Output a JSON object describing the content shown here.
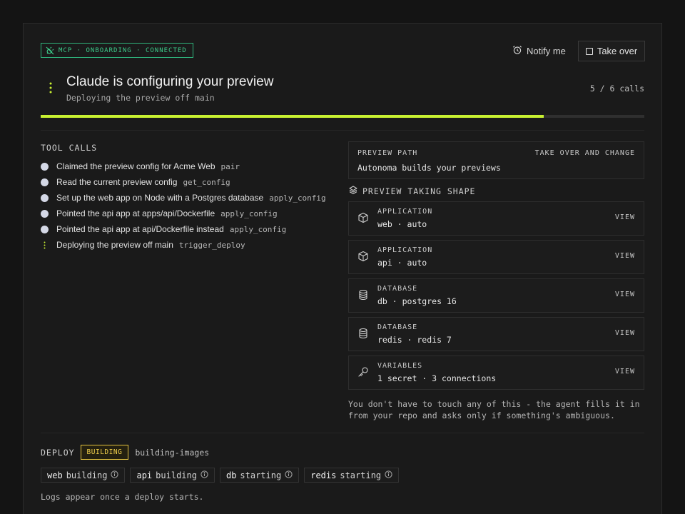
{
  "header": {
    "mcp_badge": "MCP · ONBOARDING · CONNECTED",
    "notify_label": "Notify me",
    "takeover_label": "Take over"
  },
  "status": {
    "title": "Claude is configuring your preview",
    "subtitle": "Deploying the preview off main",
    "calls_count": "5 / 6 calls",
    "progress_fraction": 0.833
  },
  "tool_calls": {
    "label": "TOOL CALLS",
    "items": [
      {
        "text": "Claimed the preview config for Acme Web",
        "tool": "pair",
        "state": "done"
      },
      {
        "text": "Read the current preview config",
        "tool": "get_config",
        "state": "done"
      },
      {
        "text": "Set up the web app on Node with a Postgres database",
        "tool": "apply_config",
        "state": "done"
      },
      {
        "text": "Pointed the api app at apps/api/Dockerfile",
        "tool": "apply_config",
        "state": "done"
      },
      {
        "text": "Pointed the api app at api/Dockerfile instead",
        "tool": "apply_config",
        "state": "done"
      },
      {
        "text": "Deploying the preview off main",
        "tool": "trigger_deploy",
        "state": "running"
      }
    ]
  },
  "preview_path": {
    "label": "PREVIEW PATH",
    "action": "TAKE OVER AND CHANGE",
    "value": "Autonoma builds your previews"
  },
  "preview_shape": {
    "label": "PREVIEW TAKING SHAPE",
    "view_label": "VIEW",
    "items": [
      {
        "type": "APPLICATION",
        "value": "web · auto",
        "icon": "cube-icon"
      },
      {
        "type": "APPLICATION",
        "value": "api · auto",
        "icon": "cube-icon"
      },
      {
        "type": "DATABASE",
        "value": "db · postgres 16",
        "icon": "database-icon"
      },
      {
        "type": "DATABASE",
        "value": "redis · redis 7",
        "icon": "database-icon"
      },
      {
        "type": "VARIABLES",
        "value": "1 secret · 3 connections",
        "icon": "key-icon"
      }
    ],
    "note": "You don't have to touch any of this - the agent fills it in from your repo and asks only if something's ambiguous."
  },
  "deploy": {
    "label": "DEPLOY",
    "badge": "BUILDING",
    "stage": "building-images",
    "services": [
      {
        "name": "web",
        "status": "building"
      },
      {
        "name": "api",
        "status": "building"
      },
      {
        "name": "db",
        "status": "starting"
      },
      {
        "name": "redis",
        "status": "starting"
      }
    ],
    "logs_note": "Logs appear once a deploy starts."
  },
  "colors": {
    "accent": "#c8f031",
    "connected": "#3ccb8a",
    "building": "#f0cf4b",
    "background": "#141414"
  }
}
